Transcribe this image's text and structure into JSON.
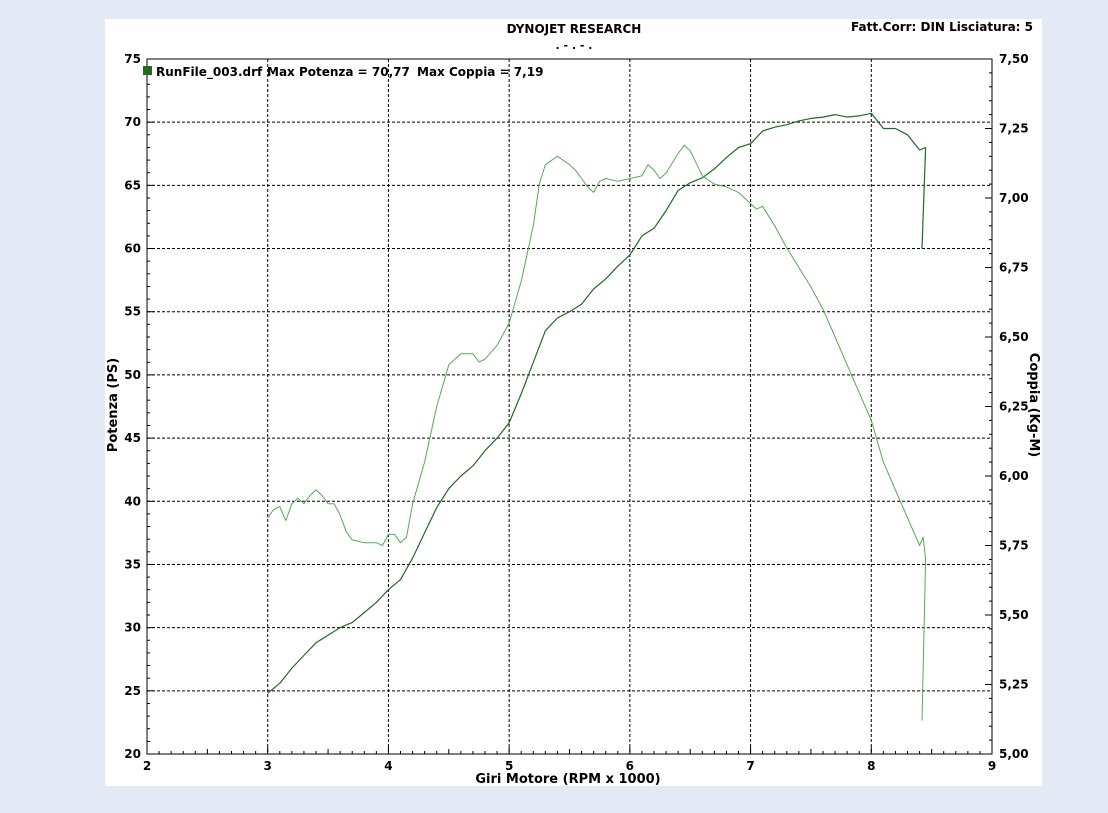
{
  "header": {
    "title": "DYNOJET RESEARCH",
    "subtitle": ". - . - .",
    "correction": "Fatt.Corr: DIN  Lisciatura: 5"
  },
  "legend": {
    "file": "RunFile_003.drf",
    "max_power": "Max Potenza = 70,77",
    "max_torque": "Max Coppia = 7,19"
  },
  "chart_data": {
    "type": "line",
    "xlabel": "Giri Motore (RPM x 1000)",
    "ylabel_left": "Potenza (PS)",
    "ylabel_right": "Coppia (Kg-M)",
    "xlim": [
      2,
      9
    ],
    "ylim_left": [
      20,
      75
    ],
    "ylim_right": [
      5.0,
      7.5
    ],
    "x_ticks": [
      "2",
      "3",
      "4",
      "5",
      "6",
      "7",
      "8",
      "9"
    ],
    "y_ticks_left": [
      "20",
      "25",
      "30",
      "35",
      "40",
      "45",
      "50",
      "55",
      "60",
      "65",
      "70",
      "75"
    ],
    "y_ticks_right": [
      "5,00",
      "5,25",
      "5,50",
      "5,75",
      "6,00",
      "6,25",
      "6,50",
      "6,75",
      "7,00",
      "7,25",
      "7,50"
    ],
    "grid": true,
    "colors": {
      "power": "#1f6b1f",
      "torque": "#55aa55",
      "legend_swatch": "#1f6b1f"
    },
    "series": [
      {
        "key": "power",
        "axis": "left",
        "x": [
          3.0,
          3.1,
          3.2,
          3.3,
          3.4,
          3.5,
          3.6,
          3.7,
          3.8,
          3.9,
          4.0,
          4.1,
          4.2,
          4.3,
          4.4,
          4.5,
          4.6,
          4.7,
          4.8,
          4.9,
          5.0,
          5.1,
          5.2,
          5.3,
          5.4,
          5.5,
          5.6,
          5.7,
          5.8,
          5.9,
          6.0,
          6.1,
          6.2,
          6.3,
          6.4,
          6.5,
          6.6,
          6.7,
          6.8,
          6.9,
          7.0,
          7.1,
          7.2,
          7.3,
          7.4,
          7.5,
          7.6,
          7.7,
          7.8,
          7.9,
          8.0,
          8.1,
          8.2,
          8.3,
          8.4,
          8.45,
          8.42
        ],
        "y": [
          24.8,
          25.6,
          26.8,
          27.8,
          28.8,
          29.4,
          30.0,
          30.4,
          31.2,
          32.0,
          33.0,
          33.8,
          35.5,
          37.5,
          39.5,
          41.0,
          42.0,
          42.8,
          44.0,
          45.0,
          46.2,
          48.5,
          51.0,
          53.5,
          54.5,
          55.0,
          55.6,
          56.8,
          57.6,
          58.6,
          59.5,
          61.0,
          61.6,
          63.0,
          64.6,
          65.2,
          65.6,
          66.3,
          67.2,
          68.0,
          68.3,
          69.3,
          69.6,
          69.8,
          70.1,
          70.3,
          70.4,
          70.6,
          70.4,
          70.5,
          70.7,
          69.5,
          69.5,
          69.0,
          67.8,
          68.0,
          60.0
        ]
      },
      {
        "key": "torque",
        "axis": "right",
        "x": [
          3.0,
          3.05,
          3.1,
          3.15,
          3.2,
          3.25,
          3.3,
          3.35,
          3.4,
          3.45,
          3.5,
          3.55,
          3.6,
          3.65,
          3.7,
          3.8,
          3.9,
          3.95,
          4.0,
          4.05,
          4.1,
          4.15,
          4.2,
          4.3,
          4.4,
          4.5,
          4.6,
          4.7,
          4.75,
          4.8,
          4.9,
          5.0,
          5.1,
          5.2,
          5.25,
          5.3,
          5.4,
          5.5,
          5.55,
          5.6,
          5.65,
          5.7,
          5.75,
          5.8,
          5.9,
          6.0,
          6.1,
          6.15,
          6.2,
          6.25,
          6.3,
          6.4,
          6.45,
          6.5,
          6.6,
          6.7,
          6.8,
          6.9,
          7.0,
          7.05,
          7.1,
          7.2,
          7.3,
          7.4,
          7.5,
          7.6,
          7.7,
          7.8,
          7.9,
          8.0,
          8.1,
          8.2,
          8.3,
          8.35,
          8.4,
          8.43,
          8.45,
          8.42
        ],
        "y": [
          5.85,
          5.88,
          5.89,
          5.84,
          5.9,
          5.92,
          5.9,
          5.93,
          5.95,
          5.93,
          5.9,
          5.9,
          5.86,
          5.8,
          5.77,
          5.76,
          5.76,
          5.75,
          5.79,
          5.79,
          5.76,
          5.78,
          5.9,
          6.05,
          6.25,
          6.4,
          6.44,
          6.44,
          6.41,
          6.42,
          6.47,
          6.55,
          6.7,
          6.9,
          7.05,
          7.12,
          7.15,
          7.12,
          7.1,
          7.07,
          7.04,
          7.02,
          7.06,
          7.07,
          7.06,
          7.07,
          7.08,
          7.12,
          7.1,
          7.07,
          7.09,
          7.16,
          7.19,
          7.17,
          7.08,
          7.05,
          7.04,
          7.02,
          6.98,
          6.96,
          6.97,
          6.9,
          6.82,
          6.75,
          6.68,
          6.6,
          6.5,
          6.4,
          6.3,
          6.2,
          6.05,
          5.95,
          5.85,
          5.8,
          5.75,
          5.78,
          5.7,
          5.12
        ]
      }
    ]
  }
}
